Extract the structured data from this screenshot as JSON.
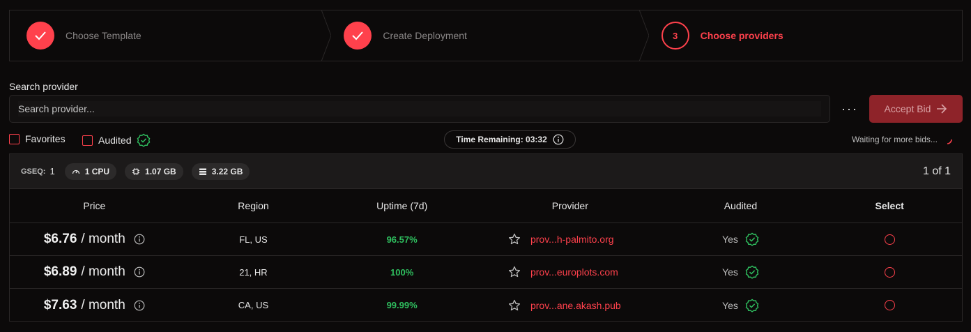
{
  "stepper": {
    "steps": [
      {
        "label": "Choose Template",
        "state": "done"
      },
      {
        "label": "Create Deployment",
        "state": "done"
      },
      {
        "label": "Choose providers",
        "state": "active",
        "number": "3"
      }
    ]
  },
  "search": {
    "label": "Search provider",
    "placeholder": "Search provider..."
  },
  "toolbar": {
    "more_label": "···",
    "accept_label": "Accept Bid"
  },
  "filters": {
    "favorites_label": "Favorites",
    "audited_label": "Audited"
  },
  "timer": {
    "text": "Time Remaining: 03:32"
  },
  "status": {
    "waiting_text": "Waiting for more bids..."
  },
  "group": {
    "gseq_label": "GSEQ:",
    "gseq_value": "1",
    "cpu": "1 CPU",
    "memory": "1.07 GB",
    "storage": "3.22 GB",
    "pager": "1 of 1"
  },
  "table": {
    "headers": {
      "price": "Price",
      "region": "Region",
      "uptime": "Uptime (7d)",
      "provider": "Provider",
      "audited": "Audited",
      "select": "Select"
    },
    "rows": [
      {
        "price": "$6.76",
        "per": "/ month",
        "region": "FL, US",
        "uptime": "96.57%",
        "provider": "prov...h-palmito.org",
        "audited": "Yes"
      },
      {
        "price": "$6.89",
        "per": "/ month",
        "region": "21, HR",
        "uptime": "100%",
        "provider": "prov...europlots.com",
        "audited": "Yes"
      },
      {
        "price": "$7.63",
        "per": "/ month",
        "region": "CA, US",
        "uptime": "99.99%",
        "provider": "prov...ane.akash.pub",
        "audited": "Yes"
      }
    ]
  },
  "colors": {
    "accent": "#ff414c",
    "success": "#2fbf5f",
    "background": "#0c0a0a",
    "accept_disabled": "#8e2329"
  }
}
